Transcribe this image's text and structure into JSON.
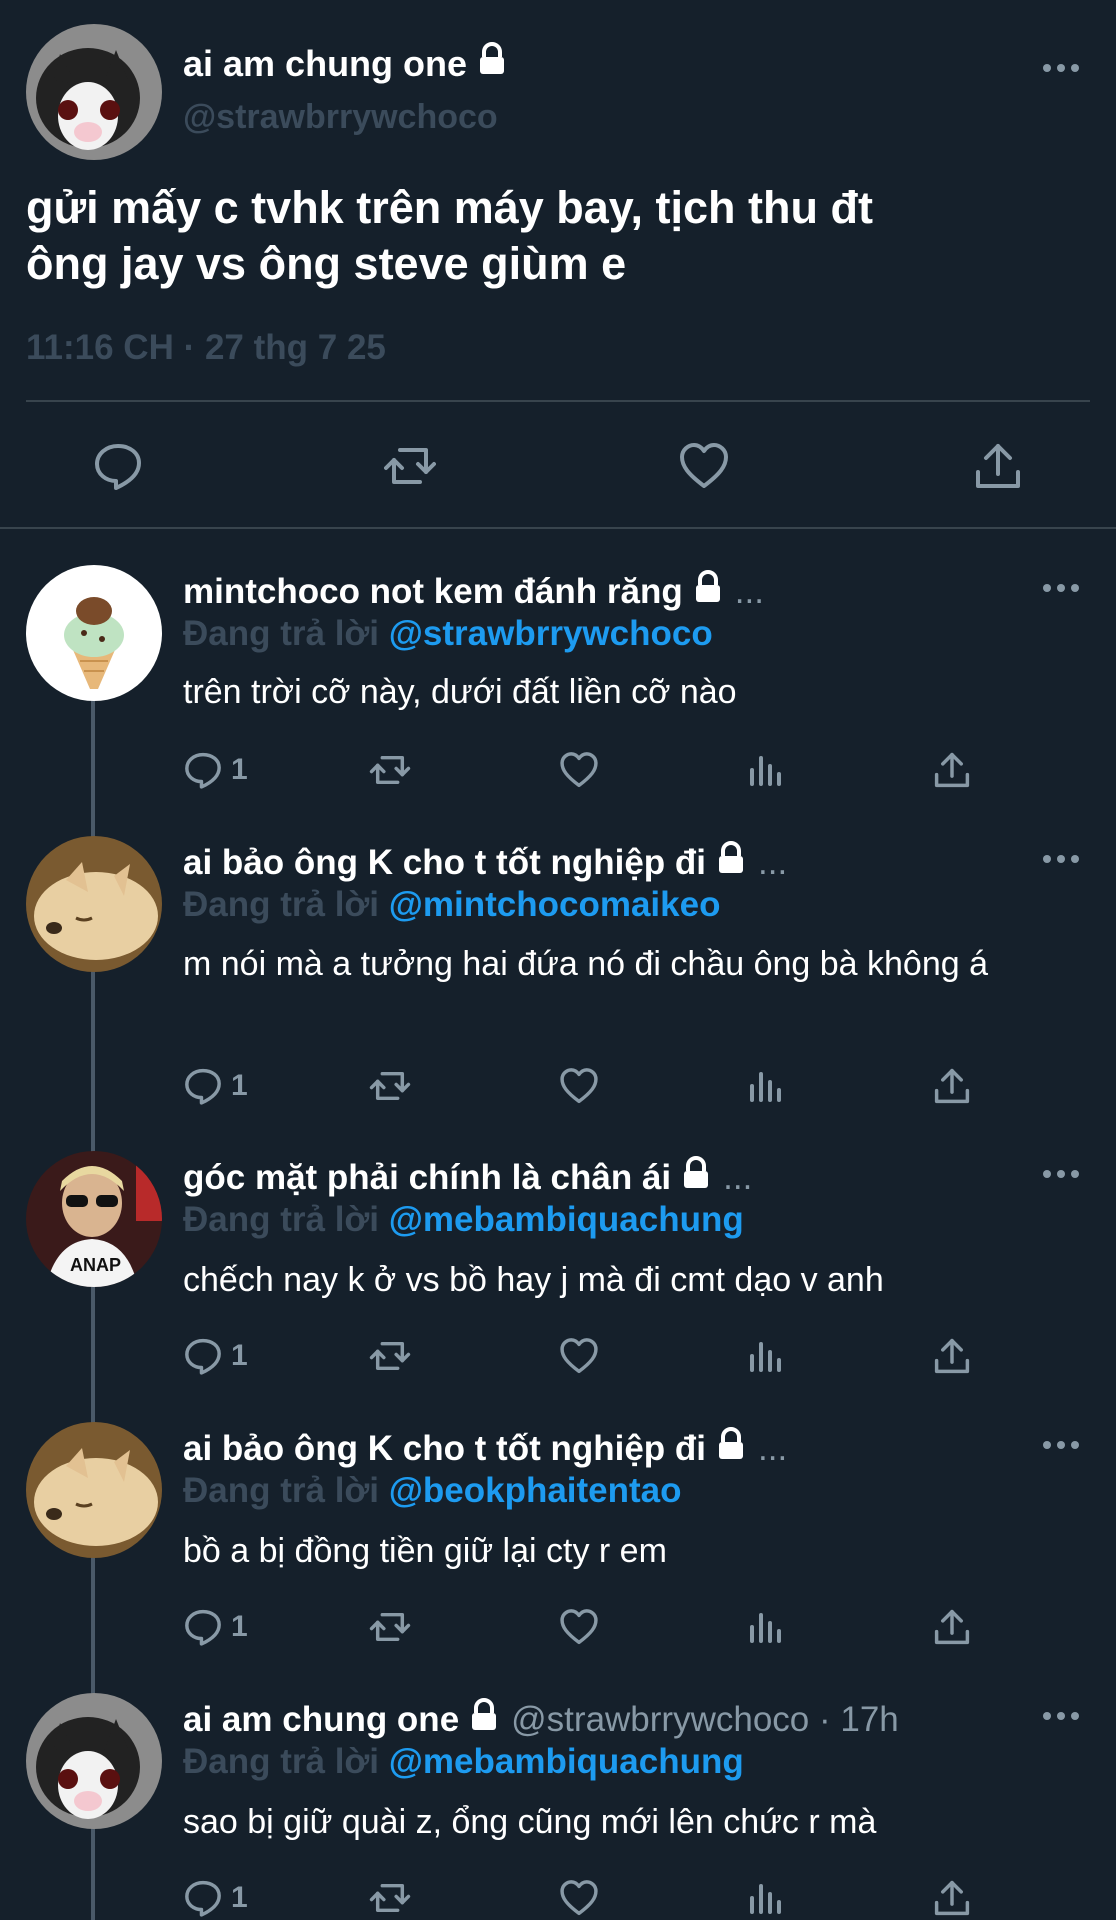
{
  "main_tweet": {
    "display_name": "ai am chung one",
    "handle": "@strawbrrywchoco",
    "text_line1": "gửi mấy c tvhk trên máy bay, tịch thu đt",
    "text_line2": "ông jay vs ông steve giùm e",
    "timestamp": "11:16 CH · 27 thg 7 25",
    "actions": [
      "reply-icon",
      "retweet-icon",
      "like-icon",
      "share-icon"
    ]
  },
  "replies": [
    {
      "display_name": "mintchoco not kem đánh răng",
      "name_tail": "...",
      "replying_label": "Đang trả lời",
      "mention": "@strawbrrywchoco",
      "text": "trên trời cỡ này, dưới đất liền cỡ nào",
      "reply_count": "1"
    },
    {
      "display_name": "ai bảo ông K cho t tốt nghiệp đi",
      "name_tail": "...",
      "replying_label": "Đang trả lời",
      "mention": "@mintchocomaikeo",
      "text": "m nói mà a tưởng hai đứa nó đi chầu ông bà không á",
      "reply_count": "1"
    },
    {
      "display_name": "góc mặt phải chính là chân ái",
      "name_tail": "...",
      "replying_label": "Đang trả lời",
      "mention": "@mebambiquachung",
      "text": "chếch nay k ở vs bồ hay j mà đi cmt dạo v anh",
      "reply_count": "1"
    },
    {
      "display_name": "ai bảo ông K cho t tốt nghiệp đi",
      "name_tail": "...",
      "replying_label": "Đang trả lời",
      "mention": "@beokphaitentao",
      "text": "bồ a bị đồng tiền giữ lại cty r em",
      "reply_count": "1"
    },
    {
      "display_name": "ai am chung one",
      "name_tail": "@strawbrrywchoco · 17h",
      "replying_label": "Đang trả lời",
      "mention": "@mebambiquachung",
      "text": "sao bị giữ quài z, ổng cũng mới lên chức r mà",
      "reply_count": "1"
    }
  ],
  "colors": {
    "background": "#15202b",
    "mention": "#1d9bf0",
    "secondary": "#8899a6",
    "divider": "#38444d"
  }
}
